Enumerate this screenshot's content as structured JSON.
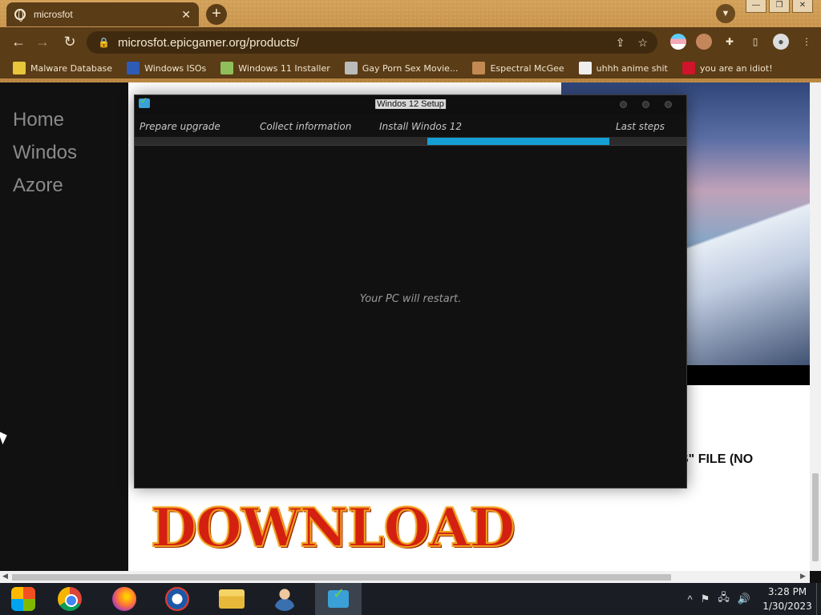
{
  "browser": {
    "tab_title": "microsfot",
    "tab_close": "✕",
    "new_tab": "+",
    "window_controls": {
      "minimize": "—",
      "restore": "❐",
      "close": "✕"
    },
    "url": "microsfot.epicgamer.org/products/",
    "nav": {
      "back": "←",
      "forward": "→",
      "reload": "↻"
    },
    "bookmarks": [
      {
        "label": "Malware Database",
        "icon": "yellow-star-icon",
        "color": "#e8c53a"
      },
      {
        "label": "Windows ISOs",
        "icon": "x-logo-icon",
        "color": "#2e5bb8"
      },
      {
        "label": "Windows 11 Installer",
        "icon": "image-icon",
        "color": "#8fbf5a"
      },
      {
        "label": "Gay Porn Sex Movie...",
        "icon": "stamp-icon",
        "color": "#bbbbbb"
      },
      {
        "label": "Espectral McGee",
        "icon": "character-icon",
        "color": "#c28a52"
      },
      {
        "label": "uhhh anime shit",
        "icon": "anime-face-icon",
        "color": "#eeeeee"
      },
      {
        "label": "you are an idiot!",
        "icon": "uk-flag-icon",
        "color": "#cf142b"
      }
    ]
  },
  "page": {
    "sidebar_links": [
      "Home",
      "Windos",
      "Azore"
    ],
    "partial_text": "S\" FILE (NO",
    "download_banner": "DOWNLOAD"
  },
  "setup": {
    "title": "Windos 12 Setup",
    "steps": [
      "Prepare upgrade",
      "Collect information",
      "Install Windos 12",
      "Last steps"
    ],
    "progress_percent": 33,
    "progress_start_percent": 53,
    "message": "Your PC will restart.",
    "accent_color": "#14a0d4"
  },
  "taskbar": {
    "apps": [
      "start-icon",
      "chrome-icon",
      "firefox-icon",
      "obama-icon",
      "file-explorer-icon",
      "user-icon",
      "windos-setup-icon"
    ],
    "tray_chevron": "^",
    "time": "3:28 PM",
    "date": "1/30/2023"
  }
}
